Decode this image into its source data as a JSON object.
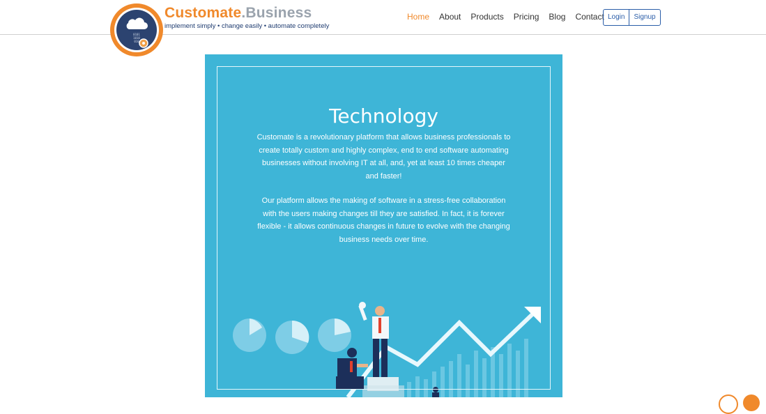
{
  "brand": {
    "name_part1": "Customate",
    "name_part2": ".Business",
    "tagline": "implement simply • change easily • automate completely"
  },
  "nav": {
    "items": [
      "Home",
      "About",
      "Products",
      "Pricing",
      "Blog",
      "Contact"
    ],
    "active": "Home"
  },
  "auth": {
    "login": "Login",
    "signup": "Signup"
  },
  "hero": {
    "title": "Technology",
    "paragraph1": "Customate is a revolutionary platform that allows business professionals to create totally custom and highly complex, end to end software automating businesses without involving IT at all, and, yet at least 10 times cheaper and faster!",
    "paragraph2": "Our platform allows the making of software in a stress-free collaboration with the users making changes till they are satisfied. In fact, it is forever flexible - it allows continuous changes in future to evolve with the changing business needs over time."
  },
  "colors": {
    "accent": "#f0892b",
    "navy": "#1f3c70",
    "card": "#3eb5d7",
    "link_blue": "#2a5da8"
  },
  "icons": {
    "logo": "cloud-gear-logo-icon",
    "illustration": "growth-chart-businessmen-illustration"
  }
}
